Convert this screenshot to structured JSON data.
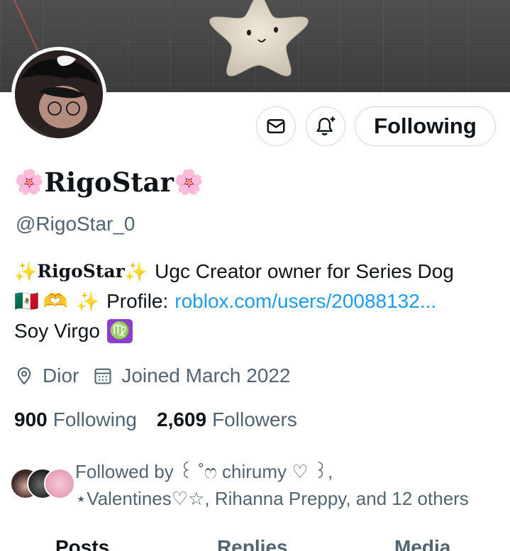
{
  "profile": {
    "display_name": "RigoStar",
    "name_flower": "🌸",
    "handle": "@RigoStar_0",
    "following_button": "Following",
    "bio": {
      "line1_name": "RigoStar",
      "line1_rest": "Ugc Creator owner for Series Dog",
      "line2_flag": "🇲🇽",
      "line2_hands": "🫶",
      "line2_label": "Profile:",
      "line2_link": "roblox.com/users/20088132...",
      "line3_text": "Soy Virgo",
      "line3_sign": "♍",
      "sparkle": "✨"
    },
    "location": "Dior",
    "joined": "Joined March 2022",
    "following_count": "900",
    "following_label": "Following",
    "followers_count": "2,609",
    "followers_label": "Followers",
    "followed_by": "Followed by ꒰ ˚ෆ chirumy ♡ ꒱, ⋆Valentines♡☆, Rihanna Preppy, and 12 others"
  },
  "tabs": [
    "Posts",
    "Replies",
    "Media"
  ],
  "icons": {
    "message": "mail-icon",
    "notify": "bell-plus-icon",
    "location": "location-pin-icon",
    "calendar": "calendar-icon"
  },
  "colors": {
    "link": "#1d9bf0",
    "secondary_text": "#536471",
    "primary_text": "#0f1419"
  }
}
